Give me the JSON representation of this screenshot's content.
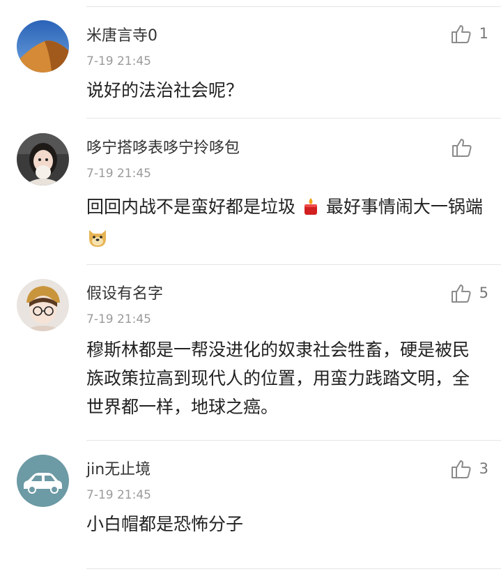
{
  "comments": [
    {
      "username": "米唐言寺0",
      "time": "7-19 21:45",
      "text": "说好的法治社会呢？",
      "likes": "1",
      "avatar_icon": "desert-dune-avatar"
    },
    {
      "username": "哆宁搭哆表哆宁拎哆包",
      "time": "7-19 21:45",
      "text_a": "回回内战不是蛮好都是垃圾",
      "text_b": "最好事情闹大一锅端",
      "likes": "",
      "avatar_icon": "girl-photo-avatar",
      "emoji_1": "candle-emoji",
      "emoji_2": "doge-emoji"
    },
    {
      "username": "假设有名字",
      "time": "7-19 21:45",
      "text": "穆斯林都是一帮没进化的奴隶社会牲畜，硬是被民族政策拉高到现代人的位置，用蛮力践踏文明，全世界都一样，地球之癌。",
      "likes": "5",
      "avatar_icon": "girl-glasses-avatar"
    },
    {
      "username": "jin无止境",
      "time": "7-19 21:45",
      "text": "小白帽都是恐怖分子",
      "likes": "3",
      "avatar_icon": "car-avatar"
    }
  ],
  "colors": {
    "avatar_car_bg": "#6c9aa5",
    "divider": "#e6e6e6",
    "like_icon": "#8a8a8a"
  }
}
